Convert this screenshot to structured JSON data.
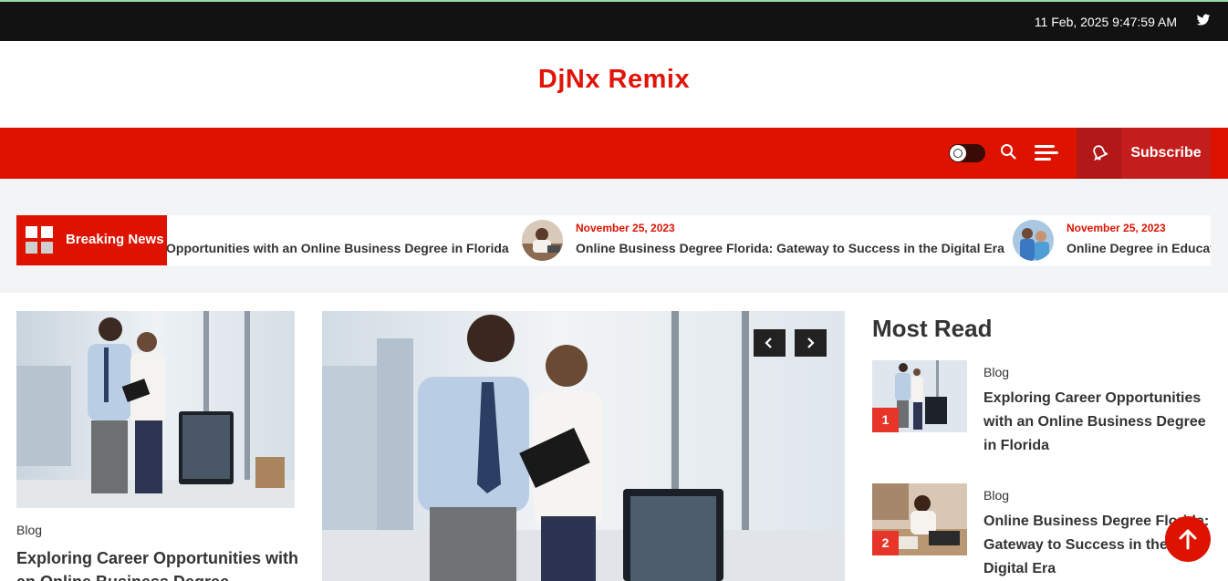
{
  "topbar": {
    "datetime": "11 Feb, 2025 9:47:59 AM",
    "social_icon": "twitter-icon"
  },
  "site": {
    "title": "DjNx Remix"
  },
  "nav": {
    "subscribe_label": "Subscribe",
    "icons": [
      "theme-toggle-icon",
      "search-icon",
      "menu-icon",
      "bell-icon"
    ]
  },
  "ticker": {
    "label": "Breaking News",
    "items": [
      {
        "title": "Opportunities with an Online Business Degree in Florida"
      },
      {
        "date": "November 25, 2023",
        "title": "Online Business Degree Florida: Gateway to Success in the Digital Era"
      },
      {
        "date": "November 25, 2023",
        "title": "Online Degree in Educat"
      }
    ]
  },
  "featured_card": {
    "category": "Blog",
    "title": "Exploring Career Opportunities with an Online Business Degree"
  },
  "most_read": {
    "heading": "Most Read",
    "items": [
      {
        "rank": "1",
        "category": "Blog",
        "title": "Exploring Career Opportunities with an Online Business Degree in Florida"
      },
      {
        "rank": "2",
        "category": "Blog",
        "title": "Online Business Degree Florida: Gateway to Success in the Digital Era"
      }
    ]
  },
  "colors": {
    "primary": "#dd1300",
    "topbar": "#121212",
    "accent_badge": "#e8352a"
  }
}
